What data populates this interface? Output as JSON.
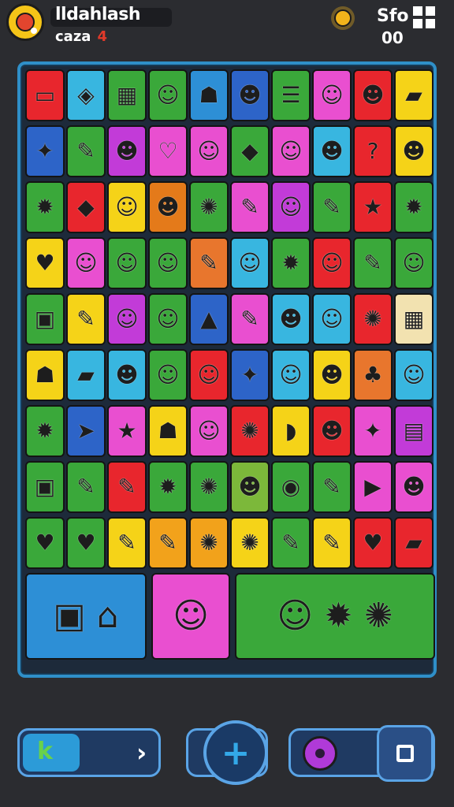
{
  "player": {
    "name": "lldahlash",
    "level_label": "caza",
    "level_value": "4"
  },
  "stats": {
    "top_value": "Sfo",
    "bottom_value": "00"
  },
  "icons": {
    "avatar": "avatar-badge",
    "sun": "sun-icon",
    "menu": "grid-menu-icon",
    "play": "play-arrow-icon",
    "add": "plus-icon",
    "settings": "gear-icon",
    "stop": "stop-icon"
  },
  "colors": {
    "background": "#2b2c30",
    "board_border": "#2f8fc8",
    "button_blue": "#1f3a62"
  },
  "board": {
    "rows": [
      [
        {
          "c": "#e8262d",
          "g": "▭"
        },
        {
          "c": "#38b6e0",
          "g": "◈"
        },
        {
          "c": "#3aa83a",
          "g": "▦"
        },
        {
          "c": "#3aa83a",
          "g": "☺"
        },
        {
          "c": "#2d8fd6",
          "g": "☗"
        },
        {
          "c": "#2d64c8",
          "g": "☻"
        },
        {
          "c": "#3aa83a",
          "g": "☰"
        },
        {
          "c": "#e94fd0",
          "g": "☺"
        },
        {
          "c": "#e8262d",
          "g": "☻"
        },
        {
          "c": "#f5d318",
          "g": "▰"
        }
      ],
      [
        {
          "c": "#2d64c8",
          "g": "✦"
        },
        {
          "c": "#3aa83a",
          "g": "✎"
        },
        {
          "c": "#c23bd8",
          "g": "☻"
        },
        {
          "c": "#e94fd0",
          "g": "♡"
        },
        {
          "c": "#e94fd0",
          "g": "☺"
        },
        {
          "c": "#3aa83a",
          "g": "◆"
        },
        {
          "c": "#e94fd0",
          "g": "☺"
        },
        {
          "c": "#38b6e0",
          "g": "☻"
        },
        {
          "c": "#e8262d",
          "g": "?"
        },
        {
          "c": "#f5d318",
          "g": "☻"
        }
      ],
      [
        {
          "c": "#3aa83a",
          "g": "✹"
        },
        {
          "c": "#e8262d",
          "g": "◆"
        },
        {
          "c": "#f5d318",
          "g": "☺"
        },
        {
          "c": "#e47a1a",
          "g": "☻"
        },
        {
          "c": "#3aa83a",
          "g": "✺"
        },
        {
          "c": "#e94fd0",
          "g": "✎"
        },
        {
          "c": "#c23bd8",
          "g": "☺"
        },
        {
          "c": "#3aa83a",
          "g": "✎"
        },
        {
          "c": "#e8262d",
          "g": "★"
        },
        {
          "c": "#3aa83a",
          "g": "✹"
        }
      ],
      [
        {
          "c": "#f5d318",
          "g": "♥"
        },
        {
          "c": "#e94fd0",
          "g": "☺"
        },
        {
          "c": "#3aa83a",
          "g": "☺"
        },
        {
          "c": "#3aa83a",
          "g": "☺"
        },
        {
          "c": "#e8762d",
          "g": "✎"
        },
        {
          "c": "#38b6e0",
          "g": "☺"
        },
        {
          "c": "#3aa83a",
          "g": "✹"
        },
        {
          "c": "#e8262d",
          "g": "☺"
        },
        {
          "c": "#3aa83a",
          "g": "✎"
        },
        {
          "c": "#3aa83a",
          "g": "☺"
        }
      ],
      [
        {
          "c": "#3aa83a",
          "g": "▣"
        },
        {
          "c": "#f5d318",
          "g": "✎"
        },
        {
          "c": "#c23bd8",
          "g": "☺"
        },
        {
          "c": "#3aa83a",
          "g": "☺"
        },
        {
          "c": "#2d64c8",
          "g": "▲"
        },
        {
          "c": "#e94fd0",
          "g": "✎"
        },
        {
          "c": "#38b6e0",
          "g": "☻"
        },
        {
          "c": "#38b6e0",
          "g": "☺"
        },
        {
          "c": "#e8262d",
          "g": "✺"
        },
        {
          "c": "#f2e2b0",
          "g": "▦"
        }
      ],
      [
        {
          "c": "#f5d318",
          "g": "☗"
        },
        {
          "c": "#38b6e0",
          "g": "▰"
        },
        {
          "c": "#38b6e0",
          "g": "☻"
        },
        {
          "c": "#3aa83a",
          "g": "☺"
        },
        {
          "c": "#e8262d",
          "g": "☺"
        },
        {
          "c": "#2d64c8",
          "g": "✦"
        },
        {
          "c": "#38b6e0",
          "g": "☺"
        },
        {
          "c": "#f5d318",
          "g": "☻"
        },
        {
          "c": "#e8762d",
          "g": "♣"
        },
        {
          "c": "#38b6e0",
          "g": "☺"
        }
      ],
      [
        {
          "c": "#3aa83a",
          "g": "✹"
        },
        {
          "c": "#2d64c8",
          "g": "➤"
        },
        {
          "c": "#e94fd0",
          "g": "★"
        },
        {
          "c": "#f5d318",
          "g": "☗"
        },
        {
          "c": "#e94fd0",
          "g": "☺"
        },
        {
          "c": "#e8262d",
          "g": "✺"
        },
        {
          "c": "#f5d318",
          "g": "◗"
        },
        {
          "c": "#e8262d",
          "g": "☻"
        },
        {
          "c": "#e94fd0",
          "g": "✦"
        },
        {
          "c": "#c23bd8",
          "g": "▤"
        }
      ],
      [
        {
          "c": "#3aa83a",
          "g": "▣"
        },
        {
          "c": "#3aa83a",
          "g": "✎"
        },
        {
          "c": "#e8262d",
          "g": "✎"
        },
        {
          "c": "#3aa83a",
          "g": "✹"
        },
        {
          "c": "#3aa83a",
          "g": "✺"
        },
        {
          "c": "#7cb83a",
          "g": "☻"
        },
        {
          "c": "#3aa83a",
          "g": "◉"
        },
        {
          "c": "#3aa83a",
          "g": "✎"
        },
        {
          "c": "#e94fd0",
          "g": "▶"
        },
        {
          "c": "#e94fd0",
          "g": "☻"
        }
      ],
      [
        {
          "c": "#3aa83a",
          "g": "♥"
        },
        {
          "c": "#3aa83a",
          "g": "♥"
        },
        {
          "c": "#f5d318",
          "g": "✎"
        },
        {
          "c": "#f2a21b",
          "g": "✎"
        },
        {
          "c": "#f2a21b",
          "g": "✺"
        },
        {
          "c": "#f5d318",
          "g": "✺"
        },
        {
          "c": "#3aa83a",
          "g": "✎"
        },
        {
          "c": "#f5d318",
          "g": "✎"
        },
        {
          "c": "#e8262d",
          "g": "♥"
        },
        {
          "c": "#e8262d",
          "g": "▰"
        }
      ]
    ],
    "bottom_cards": [
      {
        "c": "#2d8fd6",
        "g": "▣ ⌂"
      },
      {
        "c": "#e94fd0",
        "g": "☺"
      },
      {
        "c": "#3aa83a",
        "g": "☺ ✹ ✺"
      }
    ]
  }
}
